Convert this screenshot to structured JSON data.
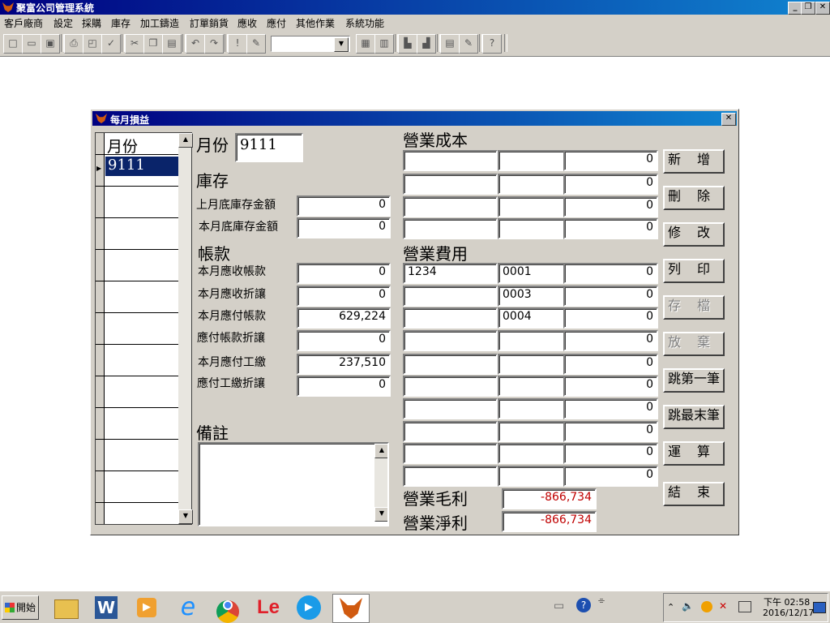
{
  "app": {
    "title": "聚富公司管理系統"
  },
  "menu": [
    "客戶廠商",
    "設定",
    "採購",
    "庫存",
    "加工鑄造",
    "訂單銷貨",
    "應收",
    "應付",
    "其他作業",
    "系統功能"
  ],
  "dialog": {
    "title": "每月損益",
    "grid": {
      "header": "月份",
      "selected": "9111"
    },
    "month_label": "月份",
    "month_value": "9111",
    "inventory": {
      "header": "庫存",
      "rows": [
        {
          "label": "上月底庫存金額",
          "value": "0"
        },
        {
          "label": "本月底庫存金額",
          "value": "0"
        }
      ]
    },
    "accounts": {
      "header": "帳款",
      "rows": [
        {
          "label": "本月應收帳款",
          "value": "0"
        },
        {
          "label": "本月應收折讓",
          "value": "0"
        },
        {
          "label": "本月應付帳款",
          "value": "629,224"
        },
        {
          "label": "應付帳款折讓",
          "value": "0"
        },
        {
          "label": "本月應付工繳",
          "value": "237,510"
        },
        {
          "label": "應付工繳折讓",
          "value": "0"
        }
      ]
    },
    "remarks_label": "備註",
    "cost": {
      "header": "營業成本",
      "rows": [
        {
          "a": "",
          "b": "",
          "v": "0"
        },
        {
          "a": "",
          "b": "",
          "v": "0"
        },
        {
          "a": "",
          "b": "",
          "v": "0"
        },
        {
          "a": "",
          "b": "",
          "v": "0"
        }
      ]
    },
    "expense": {
      "header": "營業費用",
      "rows": [
        {
          "a": "1234",
          "b": "0001",
          "v": "0"
        },
        {
          "a": "",
          "b": "0003",
          "v": "0"
        },
        {
          "a": "",
          "b": "0004",
          "v": "0"
        },
        {
          "a": "",
          "b": "",
          "v": "0"
        },
        {
          "a": "",
          "b": "",
          "v": "0"
        },
        {
          "a": "",
          "b": "",
          "v": "0"
        },
        {
          "a": "",
          "b": "",
          "v": "0"
        },
        {
          "a": "",
          "b": "",
          "v": "0"
        },
        {
          "a": "",
          "b": "",
          "v": "0"
        },
        {
          "a": "",
          "b": "",
          "v": "0"
        }
      ]
    },
    "gross_profit": {
      "label": "營業毛利",
      "value": "-866,734"
    },
    "net_profit": {
      "label": "營業淨利",
      "value": "-866,734"
    },
    "buttons": [
      {
        "label": "新　增",
        "enabled": true
      },
      {
        "label": "刪　除",
        "enabled": true
      },
      {
        "label": "修　改",
        "enabled": true
      },
      {
        "label": "列　印",
        "enabled": true
      },
      {
        "label": "存　檔",
        "enabled": false
      },
      {
        "label": "放　棄",
        "enabled": false
      },
      {
        "label": "跳第一筆",
        "enabled": true
      },
      {
        "label": "跳最末筆",
        "enabled": true
      },
      {
        "label": "運　算",
        "enabled": true
      },
      {
        "label": "結　束",
        "enabled": true
      }
    ]
  },
  "taskbar": {
    "start": "開始",
    "time": "下午 02:58",
    "date": "2016/12/17",
    "le_text": "Le"
  },
  "colors": {
    "titlebar": "#000080",
    "face": "#d4d0c8",
    "negative": "#c00000"
  }
}
